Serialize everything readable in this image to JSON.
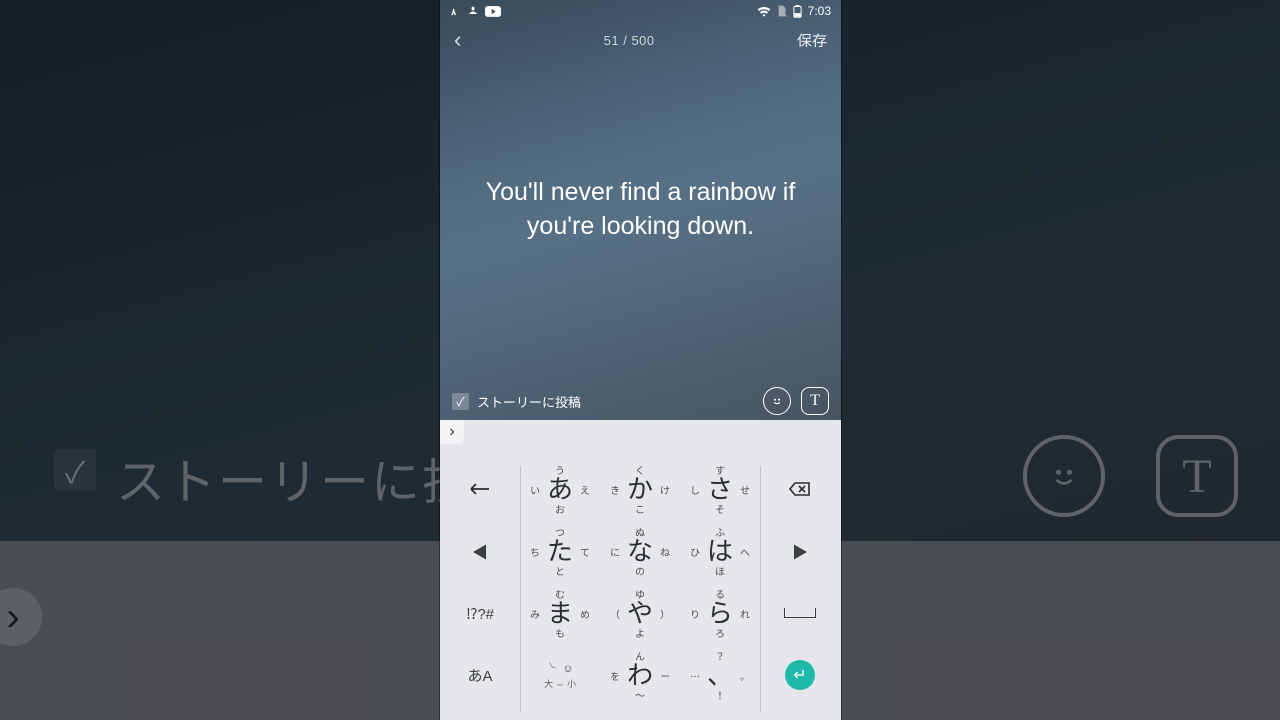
{
  "status": {
    "time": "7:03"
  },
  "header": {
    "counter": "51 / 500",
    "save": "保存"
  },
  "quote": "You'll never find a rainbow if you're looking down.",
  "options": {
    "post_to_story": "ストーリーに投稿"
  },
  "bg": {
    "post_to_story": "ストーリーに投稿",
    "text_letter": "T",
    "chev": "›"
  },
  "text_tool_letter": "T",
  "kbd": {
    "toggle": "›",
    "side": {
      "undo": "↶",
      "left": "◀",
      "symbols": "⁉?#",
      "kana": "あA",
      "backspace": "⌫",
      "right": "▶",
      "enter": "↵"
    },
    "rows": [
      [
        {
          "c": "あ",
          "t": "う",
          "b": "お",
          "l": "い",
          "r": "え"
        },
        {
          "c": "か",
          "t": "く",
          "b": "こ",
          "l": "き",
          "r": "け"
        },
        {
          "c": "さ",
          "t": "す",
          "b": "そ",
          "l": "し",
          "r": "せ"
        }
      ],
      [
        {
          "c": "た",
          "t": "つ",
          "b": "と",
          "l": "ち",
          "r": "て"
        },
        {
          "c": "な",
          "t": "ぬ",
          "b": "の",
          "l": "に",
          "r": "ね"
        },
        {
          "c": "は",
          "t": "ふ",
          "b": "ほ",
          "l": "ひ",
          "r": "へ"
        }
      ],
      [
        {
          "c": "ま",
          "t": "む",
          "b": "も",
          "l": "み",
          "r": "め"
        },
        {
          "c": "や",
          "t": "ゆ",
          "b": "よ",
          "l": "（",
          "r": "）"
        },
        {
          "c": "ら",
          "t": "る",
          "b": "ろ",
          "l": "り",
          "r": "れ"
        }
      ],
      [
        {
          "emoji": true,
          "row1": "╰ ☺",
          "row2": "大 ⇔ 小"
        },
        {
          "c": "わ",
          "t": "ん",
          "b": "〜",
          "l": "を",
          "r": "ー"
        },
        {
          "c": "、",
          "t": "？",
          "b": "！",
          "l": "⋯",
          "r": "。"
        }
      ]
    ]
  }
}
